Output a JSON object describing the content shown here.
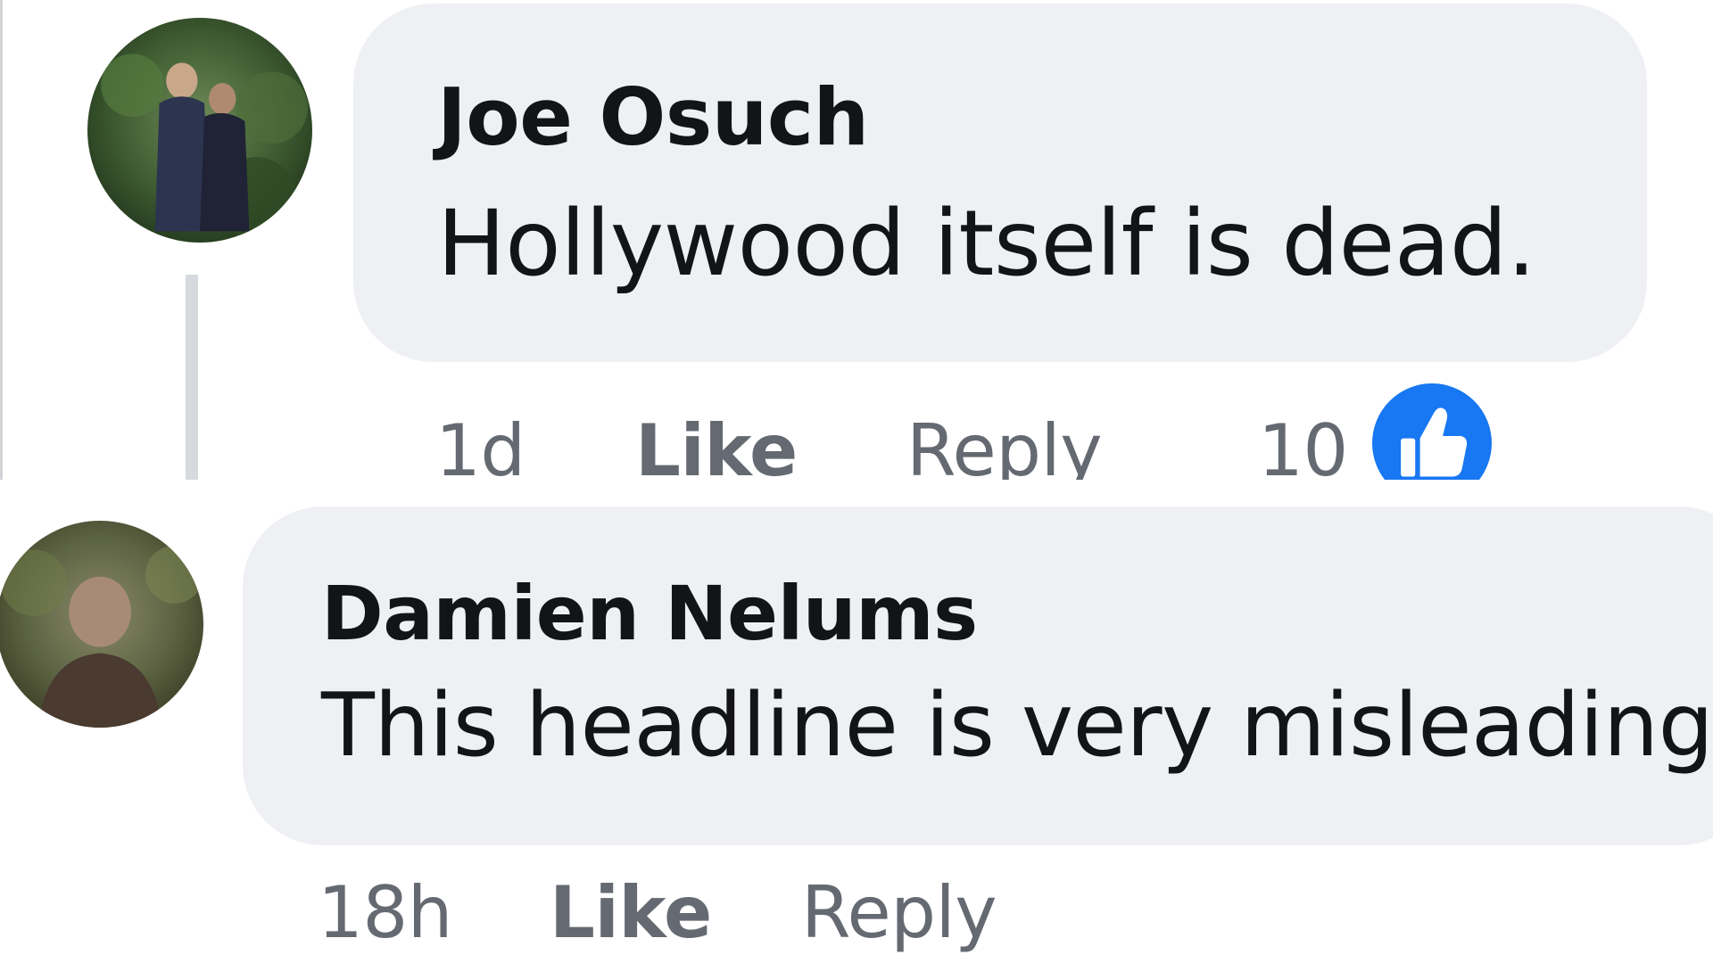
{
  "comments": [
    {
      "author": "Joe Osuch",
      "text": "Hollywood itself is dead.",
      "time": "1d",
      "like_label": "Like",
      "reply_label": "Reply",
      "reaction_count": "10",
      "reaction_icon": "thumbs-up-icon",
      "reaction_color": "#1877f2"
    },
    {
      "author": "Damien Nelums",
      "text": "This headline is very misleading!",
      "time": "18h",
      "like_label": "Like",
      "reply_label": "Reply"
    }
  ],
  "colors": {
    "bubble_bg": "#eff0f4",
    "text": "#121417",
    "meta_text": "#656a72",
    "accent": "#1877f2"
  }
}
